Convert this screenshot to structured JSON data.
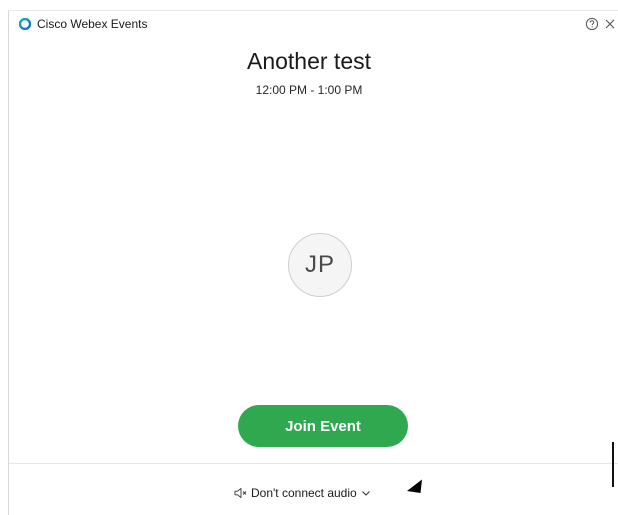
{
  "window": {
    "app_title": "Cisco Webex Events"
  },
  "event": {
    "title": "Another test",
    "time": "12:00 PM - 1:00 PM"
  },
  "user": {
    "initials": "JP"
  },
  "actions": {
    "join_label": "Join Event"
  },
  "audio": {
    "selected_option": "Don't connect audio"
  },
  "icons": {
    "app_logo": "webex-logo-icon",
    "help": "help-icon",
    "close": "close-icon",
    "speaker": "speaker-muted-icon",
    "dropdown": "chevron-down-icon"
  },
  "colors": {
    "join_button": "#2fa84f",
    "logo_blue": "#0a6fd1",
    "logo_teal": "#1fb0a4"
  }
}
